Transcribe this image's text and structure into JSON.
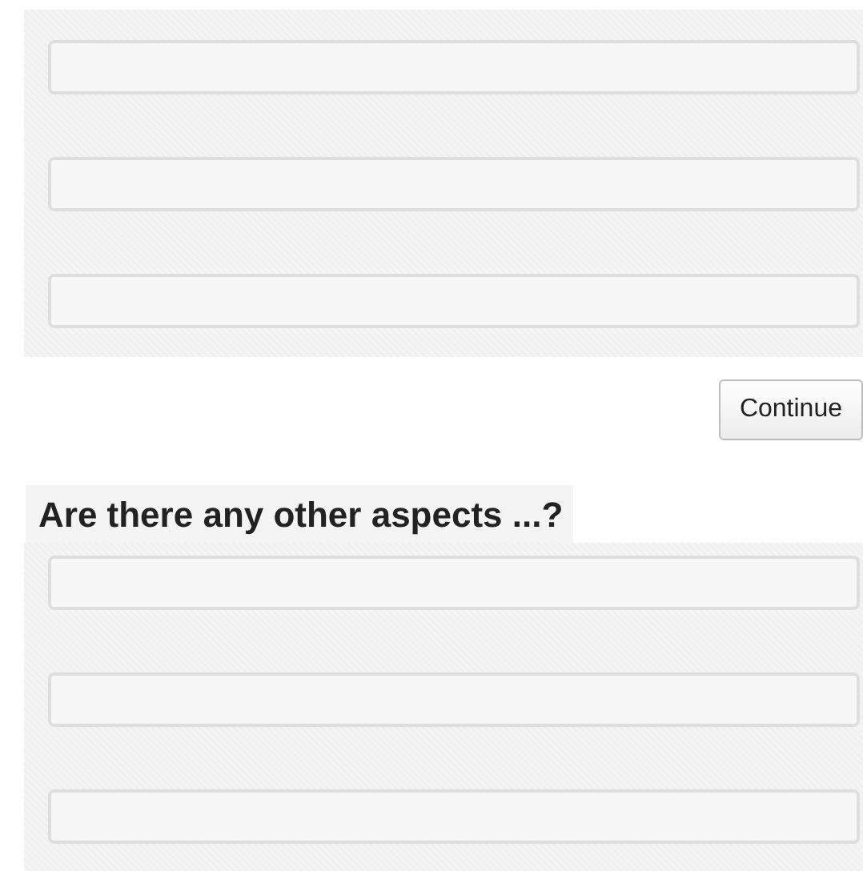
{
  "sections": [
    {
      "fields": [
        {
          "kind": "text"
        },
        {
          "kind": "text"
        },
        {
          "kind": "text"
        }
      ],
      "button": "Continue"
    },
    {
      "heading": "Are there any other aspects ...?",
      "fields": [
        {
          "kind": "text"
        },
        {
          "kind": "text"
        },
        {
          "kind": "text"
        }
      ]
    }
  ]
}
